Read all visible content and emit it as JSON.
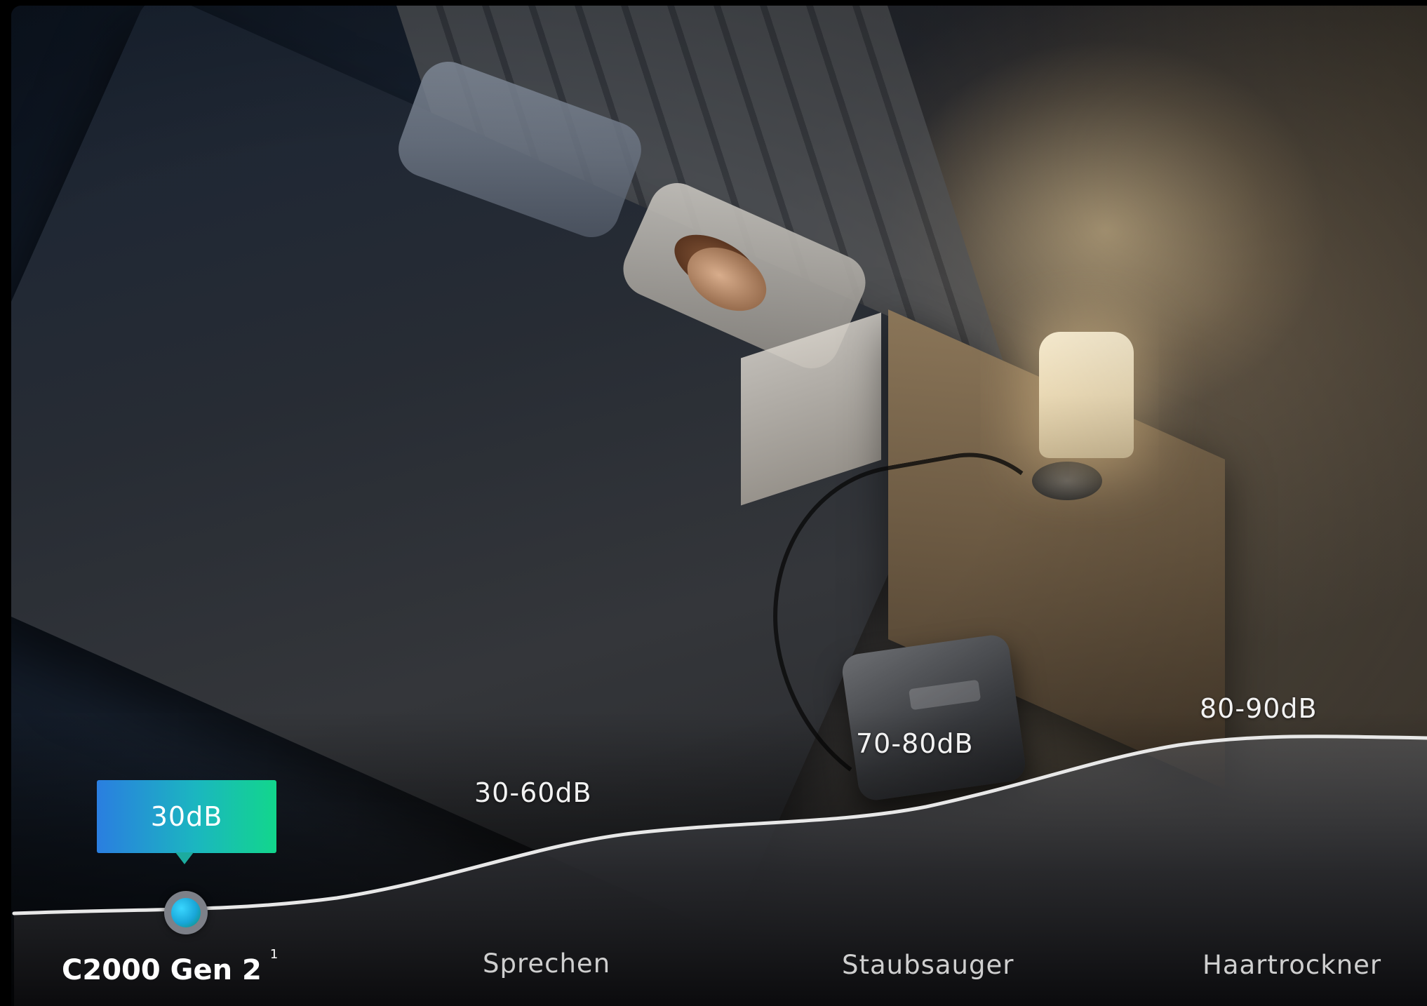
{
  "photo": {
    "scene": "night-bedroom",
    "icons": [
      "lamp-icon",
      "power-station-icon"
    ]
  },
  "noise_levels": {
    "product": {
      "label": "C2000 Gen 2",
      "footnote": "1",
      "level": "30dB"
    },
    "sources": [
      {
        "label": "Sprechen",
        "level": "30-60dB"
      },
      {
        "label": "Staubsauger",
        "level": "70-80dB"
      },
      {
        "label": "Haartrockner",
        "level": "80-90dB"
      }
    ]
  },
  "colors": {
    "badge_start": "#2a7ee0",
    "badge_end": "#12d68c",
    "curve": "#e8e8e8",
    "marker": "#19a6d8"
  }
}
